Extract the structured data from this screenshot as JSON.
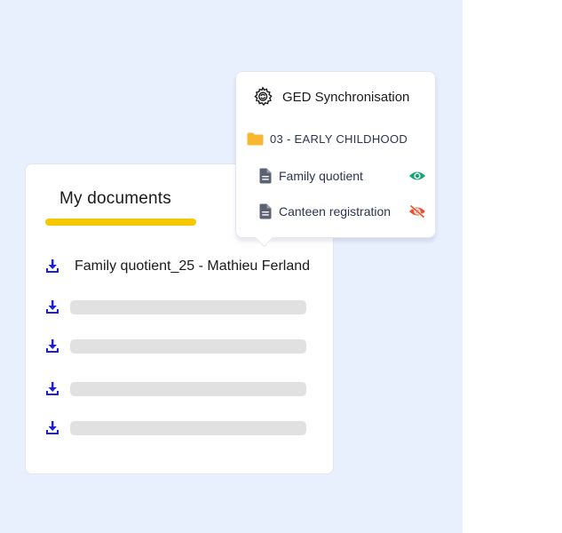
{
  "documents": {
    "title": "My documents",
    "items": [
      {
        "name": "Family quotient_25 - Mathieu Ferland"
      }
    ],
    "placeholder_rows": 4
  },
  "ged": {
    "title": "GED Synchronisation",
    "folder": "03 - EARLY CHILDHOOD",
    "files": [
      {
        "name": "Family quotient",
        "visibility": "visible",
        "eye_color": "#18a477"
      },
      {
        "name": "Canteen registration",
        "visibility": "hidden",
        "eye_color": "#e8532e"
      }
    ]
  },
  "colors": {
    "background_panel": "#e8effd",
    "accent_underline": "#f5c800",
    "download_icon": "#1b1fd6",
    "folder_icon": "#f7b731",
    "file_icon": "#5c6273",
    "skeleton": "#e1e1e1"
  },
  "icons": {
    "download": "download-icon",
    "folder": "folder-icon",
    "file": "file-icon",
    "visible": "eye-icon",
    "hidden": "eye-off-icon",
    "sync": "sync-gear-icon"
  }
}
